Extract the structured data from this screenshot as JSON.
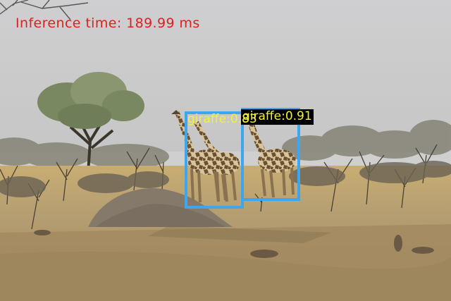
{
  "inference": {
    "text": "Inference time: 189.99 ms",
    "color": "#e02020"
  },
  "detections": [
    {
      "label": "giraffe:0.83",
      "box_color": "#3ea6ee",
      "text_color": "#f2f03a"
    },
    {
      "label": "giraffe:0.91",
      "box_color": "#3ea6ee",
      "text_color": "#f2f03a"
    }
  ],
  "scene": {
    "sky_color": "#c9c9cb",
    "ground_color": "#a58a5c",
    "grass_color": "#c4a86c",
    "mound_color": "#8a7b68",
    "giraffe_color": "#7a6344"
  }
}
